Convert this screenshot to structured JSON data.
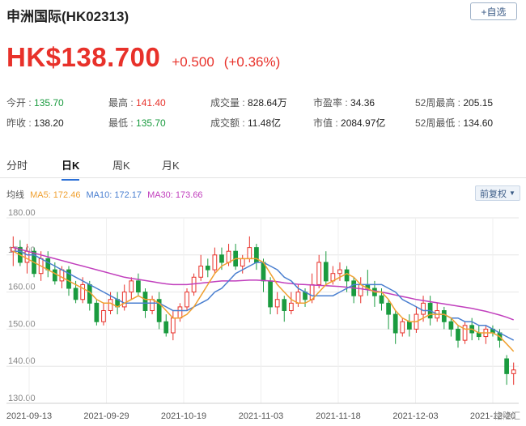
{
  "header": {
    "title": "申洲国际(HK02313)",
    "watch_label": "+自选"
  },
  "quote": {
    "price": "HK$138.700",
    "change": "+0.500",
    "change_pct": "(+0.36%)"
  },
  "stats": {
    "open_label": "今开 : ",
    "open": "135.70",
    "prev_label": "昨收 : ",
    "prev": "138.20",
    "high_label": "最高 : ",
    "high": "141.40",
    "low_label": "最低 : ",
    "low": "135.70",
    "vol_label": "成交量 : ",
    "vol": "828.64万",
    "amt_label": "成交额 : ",
    "amt": "11.48亿",
    "pe_label": "市盈率 : ",
    "pe": "34.36",
    "mcap_label": "市值 : ",
    "mcap": "2084.97亿",
    "h52_label": "52周最高 : ",
    "h52": "205.15",
    "l52_label": "52周最低 : ",
    "l52": "134.60"
  },
  "tabs": [
    "分时",
    "日K",
    "周K",
    "月K"
  ],
  "ma": {
    "label": "均线",
    "ma5": "MA5: 172.46",
    "ma10": "MA10: 172.17",
    "ma30": "MA30: 173.66",
    "fq": "前复权"
  },
  "colors": {
    "up": "#e8312a",
    "down": "#1a9b3f",
    "ma5": "#f0a030",
    "ma10": "#4a7fd0",
    "ma30": "#c13fbd",
    "watermark": "格隆汇"
  },
  "chart_data": {
    "type": "candlestick",
    "ylim": [
      130,
      180
    ],
    "yticks": [
      "180.00",
      "170.00",
      "160.00",
      "150.00",
      "140.00",
      "130.00"
    ],
    "xticks": [
      "2021-09-13",
      "2021-09-29",
      "2021-10-19",
      "2021-11-03",
      "2021-11-18",
      "2021-12-03",
      "2021-12-20"
    ],
    "candles": [
      [
        171,
        172,
        175,
        167
      ],
      [
        172,
        168,
        174,
        167
      ],
      [
        168,
        171,
        173,
        165
      ],
      [
        171,
        165,
        172,
        164
      ],
      [
        165,
        169,
        171,
        163
      ],
      [
        169,
        166,
        171,
        164
      ],
      [
        166,
        163,
        168,
        162
      ],
      [
        163,
        166,
        167,
        161
      ],
      [
        166,
        161,
        167,
        159
      ],
      [
        161,
        158,
        163,
        157
      ],
      [
        158,
        162,
        164,
        157
      ],
      [
        162,
        157,
        163,
        155
      ],
      [
        157,
        152,
        158,
        151
      ],
      [
        152,
        155,
        157,
        151
      ],
      [
        155,
        158,
        160,
        154
      ],
      [
        158,
        156,
        160,
        154
      ],
      [
        156,
        160,
        162,
        155
      ],
      [
        160,
        163,
        164,
        158
      ],
      [
        163,
        160,
        165,
        159
      ],
      [
        160,
        155,
        161,
        153
      ],
      [
        155,
        158,
        159,
        154
      ],
      [
        158,
        152,
        160,
        150
      ],
      [
        152,
        149,
        154,
        148
      ],
      [
        149,
        153,
        155,
        147
      ],
      [
        153,
        156,
        157,
        152
      ],
      [
        156,
        160,
        161,
        155
      ],
      [
        160,
        164,
        165,
        159
      ],
      [
        164,
        167,
        170,
        163
      ],
      [
        167,
        166,
        169,
        164
      ],
      [
        166,
        170,
        172,
        165
      ],
      [
        170,
        168,
        172,
        166
      ],
      [
        168,
        171,
        173,
        167
      ],
      [
        171,
        167,
        173,
        166
      ],
      [
        167,
        169,
        170,
        165
      ],
      [
        169,
        172,
        175,
        168
      ],
      [
        172,
        168,
        173,
        166
      ],
      [
        168,
        163,
        169,
        160
      ],
      [
        163,
        156,
        164,
        154
      ],
      [
        156,
        158,
        160,
        154
      ],
      [
        158,
        155,
        159,
        152
      ],
      [
        155,
        157,
        160,
        154
      ],
      [
        157,
        160,
        162,
        156
      ],
      [
        160,
        158,
        161,
        156
      ],
      [
        158,
        162,
        165,
        157
      ],
      [
        162,
        168,
        170,
        161
      ],
      [
        168,
        163,
        171,
        162
      ],
      [
        163,
        165,
        167,
        162
      ],
      [
        165,
        166,
        168,
        163
      ],
      [
        166,
        163,
        167,
        160
      ],
      [
        163,
        159,
        164,
        157
      ],
      [
        159,
        162,
        164,
        157
      ],
      [
        162,
        161,
        166,
        159
      ],
      [
        161,
        159,
        163,
        156
      ],
      [
        159,
        157,
        161,
        155
      ],
      [
        157,
        154,
        158,
        150
      ],
      [
        154,
        149,
        155,
        146
      ],
      [
        149,
        152,
        153,
        148
      ],
      [
        152,
        150,
        154,
        148
      ],
      [
        150,
        154,
        156,
        149
      ],
      [
        154,
        157,
        159,
        152
      ],
      [
        157,
        153,
        159,
        151
      ],
      [
        153,
        155,
        157,
        152
      ],
      [
        155,
        152,
        156,
        150
      ],
      [
        152,
        150,
        153,
        148
      ],
      [
        150,
        147,
        151,
        145
      ],
      [
        147,
        151,
        152,
        146
      ],
      [
        151,
        149,
        153,
        147
      ],
      [
        149,
        148,
        151,
        147
      ],
      [
        148,
        150,
        151,
        146
      ],
      [
        150,
        149,
        151,
        148
      ],
      [
        149,
        147,
        150,
        145
      ],
      [
        142,
        138,
        143,
        135
      ],
      [
        138,
        139,
        141,
        135
      ]
    ],
    "ma5": [
      171,
      170,
      169,
      168,
      167,
      166,
      165,
      164,
      163,
      162,
      161,
      160,
      158,
      157,
      157,
      156,
      157,
      158,
      159,
      158,
      158,
      157,
      155,
      153,
      153,
      154,
      156,
      159,
      162,
      165,
      167,
      168,
      169,
      169,
      169,
      169,
      168,
      165,
      162,
      160,
      158,
      157,
      157,
      158,
      160,
      162,
      163,
      164,
      165,
      164,
      162,
      161,
      160,
      160,
      158,
      155,
      153,
      152,
      152,
      153,
      154,
      154,
      154,
      153,
      151,
      150,
      150,
      149,
      149,
      149,
      148,
      146,
      144
    ],
    "ma10": [
      171,
      171,
      170,
      170,
      169,
      168,
      167,
      166,
      165,
      164,
      163,
      162,
      161,
      160,
      159,
      158,
      157,
      157,
      157,
      157,
      157,
      157,
      156,
      155,
      155,
      155,
      156,
      157,
      158,
      160,
      161,
      163,
      165,
      166,
      167,
      168,
      168,
      167,
      166,
      164,
      163,
      161,
      160,
      159,
      159,
      159,
      159,
      160,
      161,
      162,
      162,
      162,
      162,
      162,
      161,
      160,
      158,
      157,
      156,
      155,
      155,
      154,
      154,
      153,
      153,
      152,
      152,
      151,
      151,
      150,
      149,
      148,
      147
    ],
    "ma30": [
      172,
      171.5,
      171,
      170.5,
      170,
      169.5,
      169,
      168.5,
      168,
      167.5,
      167,
      166.5,
      166,
      165.5,
      165,
      164.5,
      164,
      163.7,
      163.4,
      163.1,
      162.8,
      162.5,
      162.2,
      162,
      162,
      162,
      162.2,
      162.4,
      162.6,
      162.8,
      163,
      163,
      163,
      163.1,
      163.2,
      163.2,
      163.1,
      163,
      162.8,
      162.5,
      162.3,
      162.1,
      162,
      161.9,
      161.8,
      161.7,
      161.6,
      161.5,
      161.3,
      161.1,
      160.9,
      160.6,
      160.3,
      160,
      159.6,
      159.2,
      158.8,
      158.4,
      158,
      157.7,
      157.4,
      157.1,
      156.8,
      156.5,
      156.2,
      155.9,
      155.6,
      155.2,
      154.8,
      154.3,
      153.8,
      153.2,
      152.5
    ]
  }
}
